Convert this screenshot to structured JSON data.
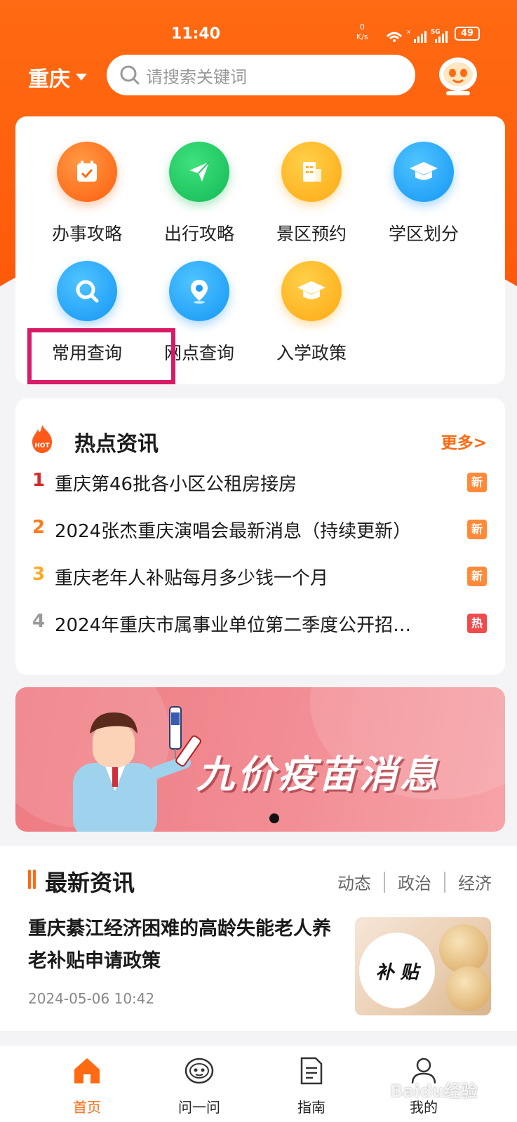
{
  "status": {
    "time": "11:40",
    "net_speed": "0",
    "net_unit": "K/s",
    "battery": "49",
    "signal": "5G"
  },
  "header": {
    "city": "重庆",
    "search_placeholder": "请搜索关键词"
  },
  "quick_menu": [
    {
      "label": "办事攻略",
      "icon": "calendar-check-icon",
      "color": "#ff6a12"
    },
    {
      "label": "出行攻略",
      "icon": "paper-plane-icon",
      "color": "#1dc463"
    },
    {
      "label": "景区预约",
      "icon": "building-icon",
      "color": "#ffb020"
    },
    {
      "label": "学区划分",
      "icon": "graduation-cap-icon",
      "color": "#1a9cf7"
    },
    {
      "label": "常用查询",
      "icon": "search-icon",
      "color": "#1a9cf7"
    },
    {
      "label": "网点查询",
      "icon": "location-pin-icon",
      "color": "#1a9cf7"
    },
    {
      "label": "入学政策",
      "icon": "graduation-cap-icon",
      "color": "#ffb020"
    }
  ],
  "hot_news": {
    "title": "热点资讯",
    "more": "更多>",
    "items": [
      {
        "rank": "1",
        "text": "重庆第46批各小区公租房接房",
        "tag": "新",
        "rank_color": "#d62a2a",
        "tag_color": "#ff8a3a"
      },
      {
        "rank": "2",
        "text": "2024张杰重庆演唱会最新消息（持续更新）",
        "tag": "新",
        "rank_color": "#ff7a1e",
        "tag_color": "#ff8a3a"
      },
      {
        "rank": "3",
        "text": "重庆老年人补贴每月多少钱一个月",
        "tag": "新",
        "rank_color": "#ffa928",
        "tag_color": "#ff8a3a"
      },
      {
        "rank": "4",
        "text": "2024年重庆市属事业单位第二季度公开招…",
        "tag": "热",
        "rank_color": "#9a9a9a",
        "tag_color": "#f04a4a"
      }
    ]
  },
  "banner": {
    "text": "九价疫苗消息"
  },
  "latest": {
    "title": "最新资讯",
    "tabs": [
      "动态",
      "政治",
      "经济"
    ],
    "article": {
      "title": "重庆綦江经济困难的高龄失能老人养老补贴申请政策",
      "time": "2024-05-06 10:42",
      "thumb_text": "补 贴"
    }
  },
  "bottom_nav": [
    {
      "label": "首页",
      "icon": "home-icon",
      "active": true
    },
    {
      "label": "问一问",
      "icon": "robot-icon",
      "active": false
    },
    {
      "label": "指南",
      "icon": "document-icon",
      "active": false
    },
    {
      "label": "我的",
      "icon": "user-icon",
      "active": false
    }
  ],
  "watermark": "Baidu经验"
}
